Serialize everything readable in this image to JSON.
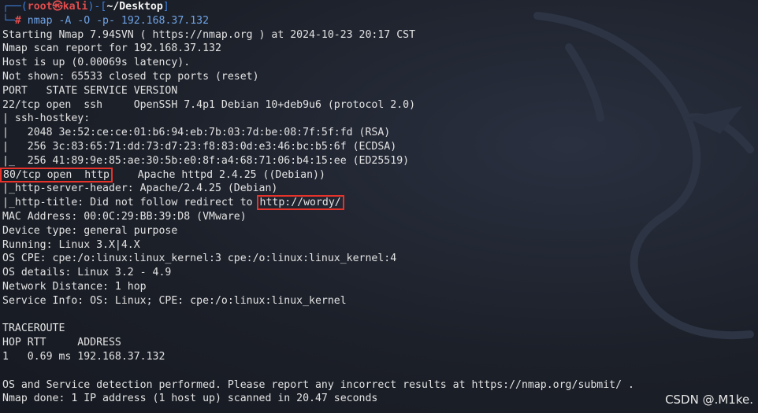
{
  "prompt": {
    "line1_start": "┌──(",
    "user": "root㉿kali",
    "mid": ")-[",
    "path": "~/Desktop",
    "line1_end": "]",
    "line2_start": "└─",
    "hash": "#",
    "command": " nmap -A -O -p- 192.168.37.132"
  },
  "output": {
    "l1": "Starting Nmap 7.94SVN ( https://nmap.org ) at 2024-10-23 20:17 CST",
    "l2": "Nmap scan report for 192.168.37.132",
    "l3": "Host is up (0.00069s latency).",
    "l4": "Not shown: 65533 closed tcp ports (reset)",
    "l5": "PORT   STATE SERVICE VERSION",
    "l6": "22/tcp open  ssh     OpenSSH 7.4p1 Debian 10+deb9u6 (protocol 2.0)",
    "l7": "| ssh-hostkey: ",
    "l8": "|   2048 3e:52:ce:ce:01:b6:94:eb:7b:03:7d:be:08:7f:5f:fd (RSA)",
    "l9": "|   256 3c:83:65:71:dd:73:d7:23:f8:83:0d:e3:46:bc:b5:6f (ECDSA)",
    "l10": "|_  256 41:89:9e:85:ae:30:5b:e0:8f:a4:68:71:06:b4:15:ee (ED25519)",
    "l11_port": "80/tcp open  http",
    "l11_rest": "    Apache httpd 2.4.25 ((Debian))",
    "l12": "|_http-server-header: Apache/2.4.25 (Debian)",
    "l13_pre": "|_http-title: Did not follow redirect to ",
    "l13_url": "http://wordy/",
    "l14": "MAC Address: 00:0C:29:BB:39:D8 (VMware)",
    "l15": "Device type: general purpose",
    "l16": "Running: Linux 3.X|4.X",
    "l17": "OS CPE: cpe:/o:linux:linux_kernel:3 cpe:/o:linux:linux_kernel:4",
    "l18": "OS details: Linux 3.2 - 4.9",
    "l19": "Network Distance: 1 hop",
    "l20": "Service Info: OS: Linux; CPE: cpe:/o:linux:linux_kernel",
    "l21": "",
    "l22": "TRACEROUTE",
    "l23": "HOP RTT     ADDRESS",
    "l24": "1   0.69 ms 192.168.37.132",
    "l25": "",
    "l26": "OS and Service detection performed. Please report any incorrect results at https://nmap.org/submit/ .",
    "l27": "Nmap done: 1 IP address (1 host up) scanned in 20.47 seconds"
  },
  "watermark": "CSDN @.M1ke.",
  "colors": {
    "highlight_box": "#e5332b",
    "prompt_bracket": "#3f7fdc",
    "prompt_user": "#e14d4d",
    "command_text": "#6fa3e6"
  }
}
